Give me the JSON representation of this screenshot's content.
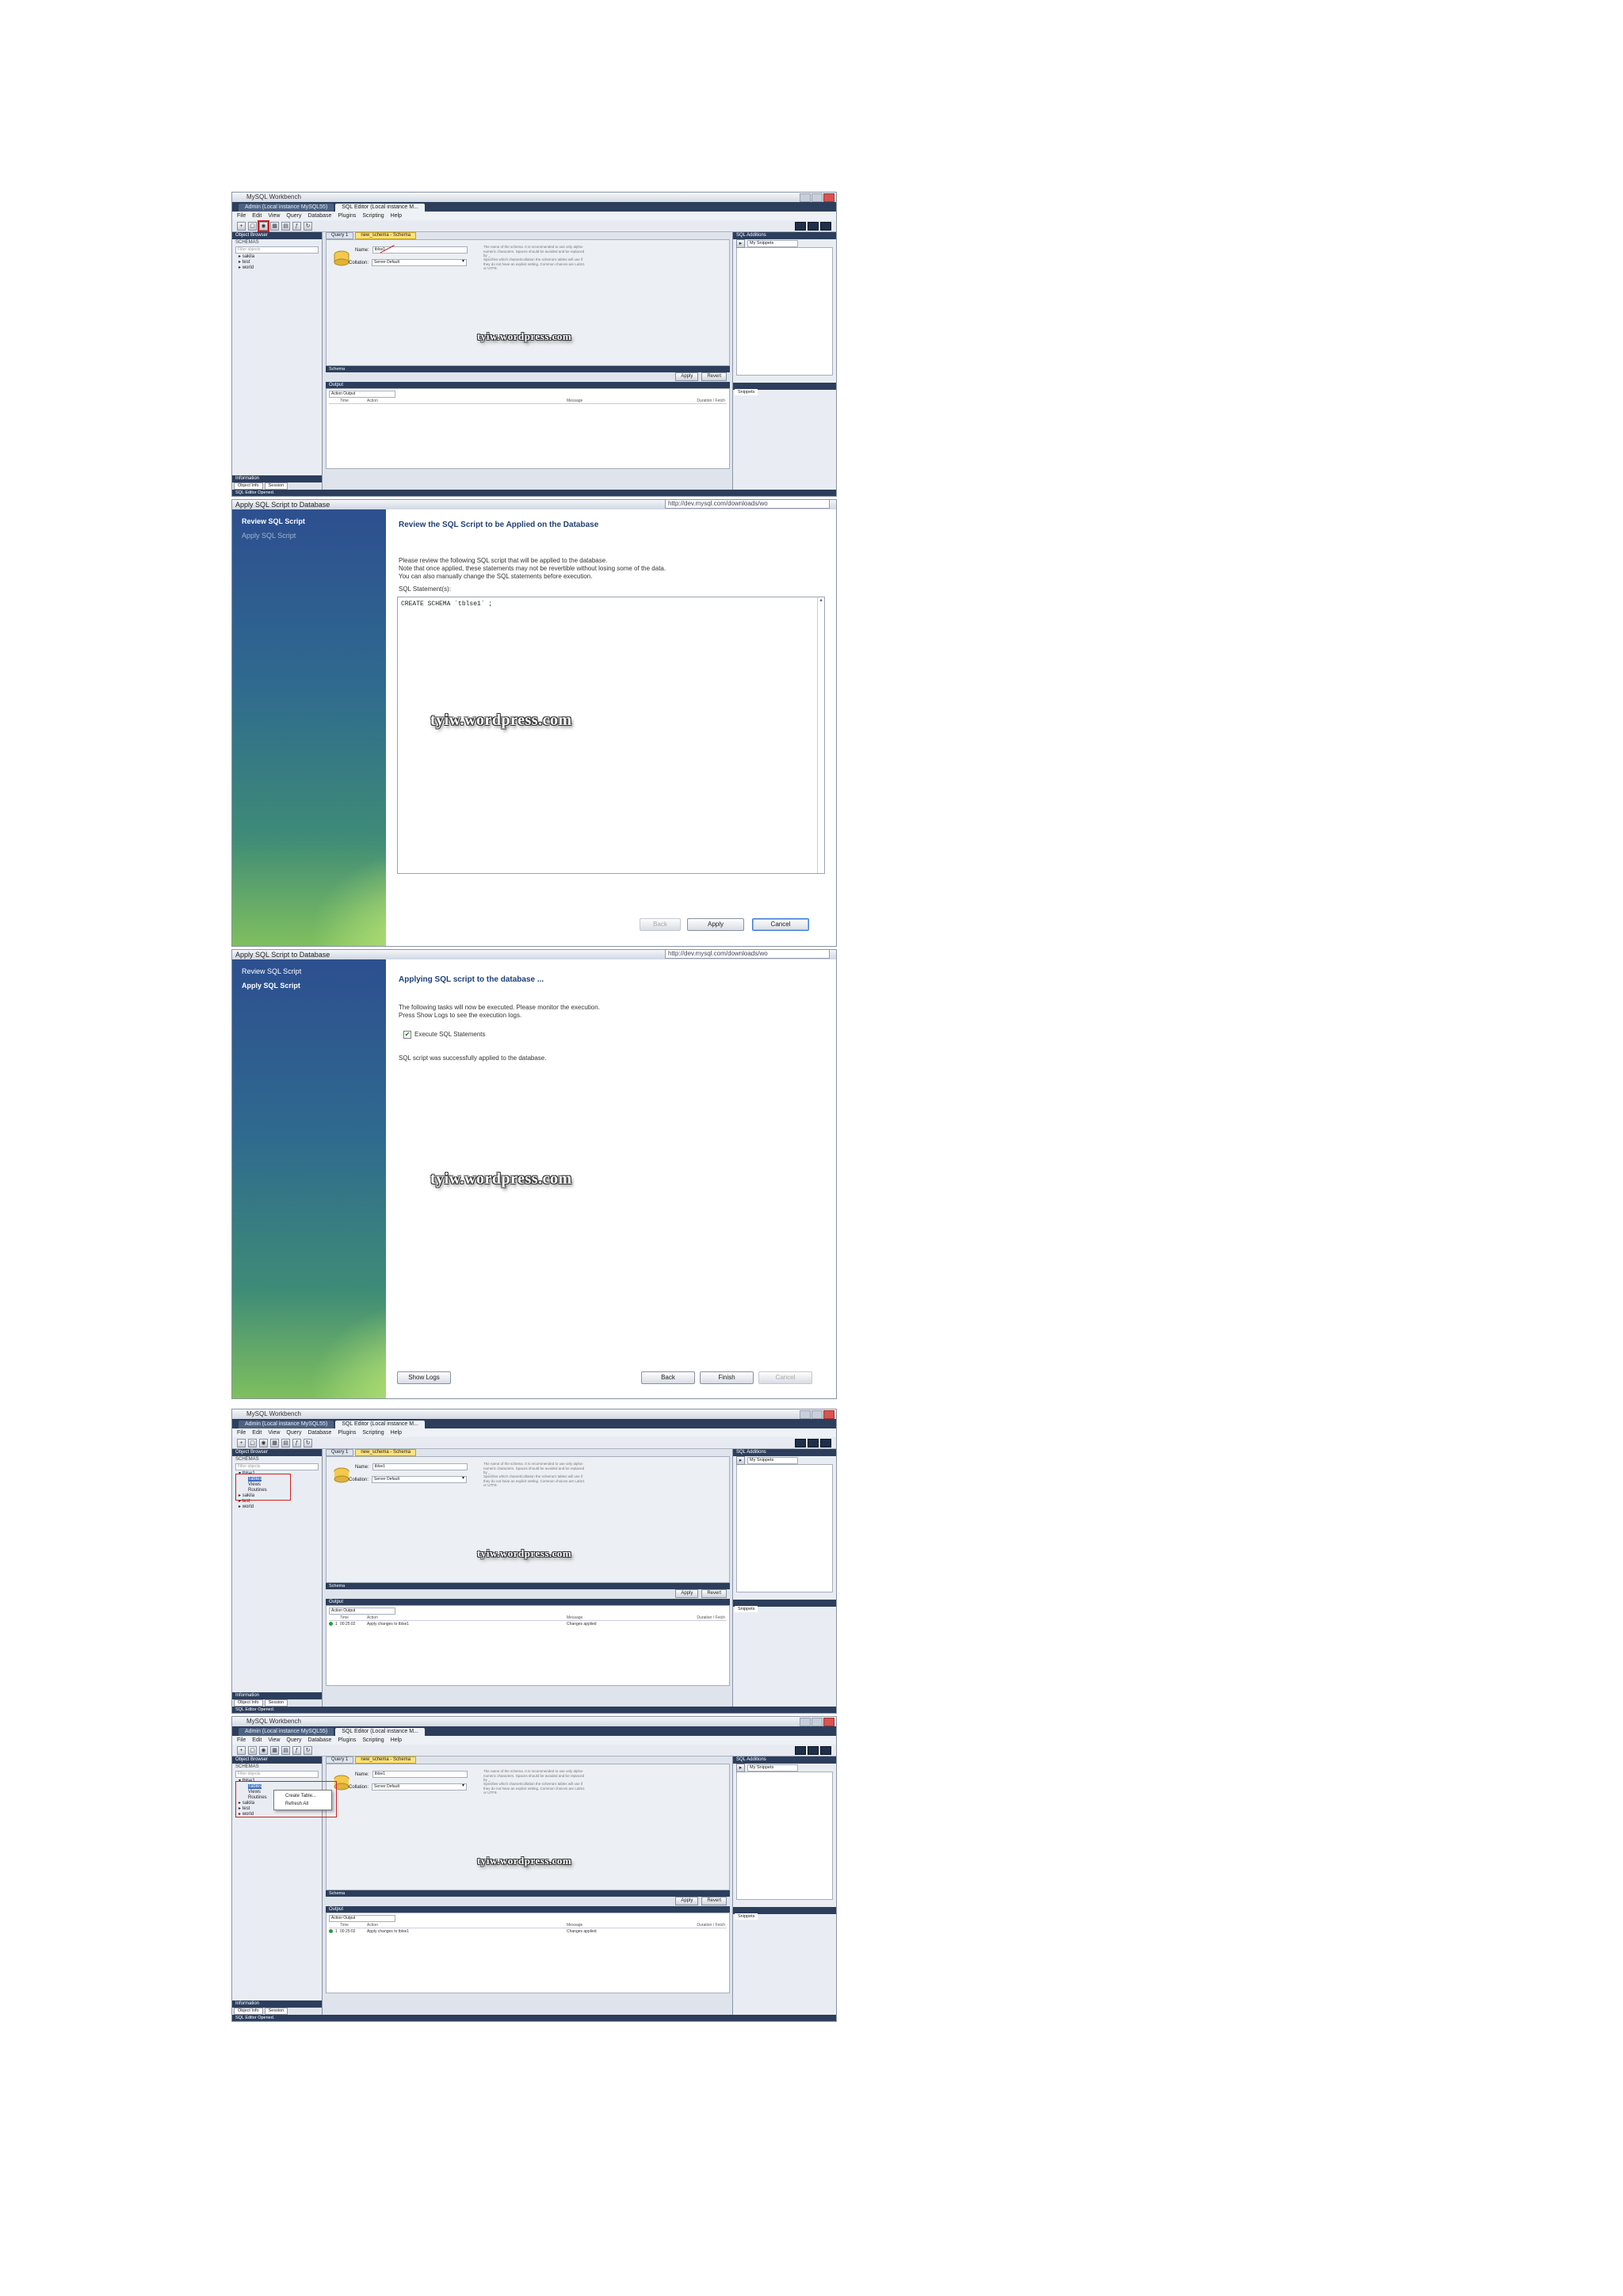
{
  "watermark": "tyiw.wordpress.com",
  "workbench": {
    "title": "MySQL Workbench",
    "tabs": [
      "Admin (Local instance MySQL55)",
      "SQL Editor (Local instance M..."
    ],
    "menu": [
      "File",
      "Edit",
      "View",
      "Query",
      "Database",
      "Plugins",
      "Scripting",
      "Help"
    ],
    "schemas_header": "Object Browser",
    "schemas_sub": "SCHEMAS",
    "filter_placeholder": "Filter objects",
    "tree_initial": [
      "sakila",
      "test",
      "world"
    ],
    "tree_expanded": {
      "root": "tblse1",
      "children": [
        "Tables",
        "Views",
        "Routines"
      ],
      "others": [
        "sakila",
        "test",
        "world"
      ]
    },
    "editor_tabs": [
      "Query 1",
      "new_schema - Schema"
    ],
    "name_label": "Name:",
    "name_value": "tblse1",
    "collation_label": "Collation:",
    "collation_value": "Server Default",
    "name_desc": "The name of the schema. It is recommended to use only alpha-numeric characters. Spaces should be avoided and be replaced by _",
    "collation_desc": "Specifies which charset/collation the schema's tables will use if they do not have an explicit setting. Common choices are Latin1 or UTF8.",
    "schema_footer": "Schema",
    "apply_label": "Apply",
    "revert_label": "Revert",
    "sql_additions": "SQL Additions",
    "snippets_label": "My Snippets",
    "snippets_tab": "Snippets",
    "output_label": "Output",
    "output_select": "Action Output",
    "out_cols": [
      "Time",
      "Action",
      "Message",
      "Duration / Fetch"
    ],
    "out_row": {
      "num": "1",
      "time": "00:25:02",
      "action": "Apply changes to tblse1",
      "message": "Changes applied"
    },
    "info_label": "Information",
    "info_tabs": [
      "Object Info",
      "Session"
    ],
    "status": "SQL Editor Opened.",
    "context_menu": [
      "Create Table...",
      "Refresh All"
    ]
  },
  "wizard": {
    "title": "Apply SQL Script to Database",
    "url": "http://dev.mysql.com/downloads/wo",
    "steps": [
      "Review SQL Script",
      "Apply SQL Script"
    ],
    "review": {
      "heading": "Review the SQL Script to be Applied on the Database",
      "line1": "Please review the following SQL script that will be applied to the database.",
      "line2": "Note that once applied, these statements may not be revertible without losing some of the data.",
      "line3": "You can also manually change the SQL statements before execution.",
      "statements_label": "SQL Statement(s):",
      "sql": "CREATE SCHEMA `tblse1` ;",
      "back": "Back",
      "apply": "Apply",
      "cancel": "Cancel"
    },
    "applying": {
      "heading": "Applying SQL script to the database ...",
      "line1": "The following tasks will now be executed. Please monitor the execution.",
      "line2": "Press Show Logs to see the execution logs.",
      "task": "Execute SQL Statements",
      "result": "SQL script was successfully applied to the database.",
      "show_logs": "Show Logs",
      "back": "Back",
      "finish": "Finish",
      "cancel": "Cancel"
    }
  }
}
